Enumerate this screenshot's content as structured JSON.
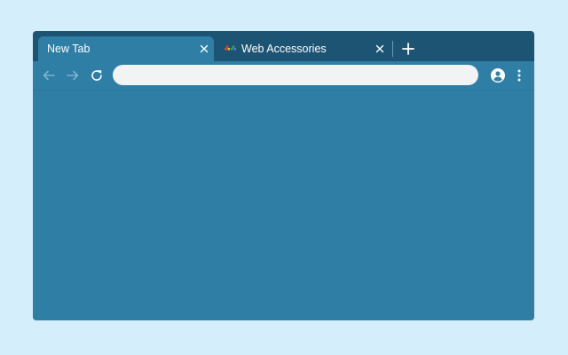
{
  "colors": {
    "page_background": "#d5eefb",
    "tabstrip": "#1e5473",
    "frame": "#2e7ea6",
    "omnibox": "#f1f3f4",
    "icon_active": "#ffffff",
    "icon_disabled": "#7fb2cf"
  },
  "tabs": [
    {
      "title": "New Tab",
      "active": true,
      "icon": "close-icon"
    },
    {
      "title": "Web Accessories",
      "active": false,
      "favicon": "web-accessories-favicon",
      "icon": "close-icon"
    }
  ],
  "new_tab_icon": "plus-icon",
  "toolbar": {
    "back_icon": "arrow-left-icon",
    "back_enabled": false,
    "forward_icon": "arrow-right-icon",
    "forward_enabled": false,
    "reload_icon": "reload-icon",
    "omnibox_value": "",
    "omnibox_placeholder": "",
    "profile_icon": "account-circle-icon",
    "menu_icon": "more-vert-icon"
  }
}
